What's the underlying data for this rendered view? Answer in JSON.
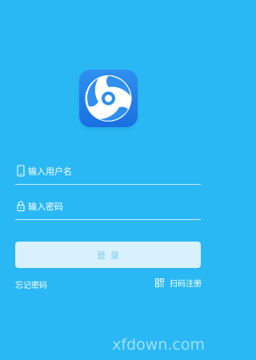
{
  "colors": {
    "background": "#2ab8f4",
    "logo_tile": "#1a6fe0",
    "button_bg": "#d8f1fc",
    "button_text": "#7fcdef"
  },
  "logo": {
    "icon": "swirl-logo-icon"
  },
  "login_form": {
    "username_placeholder": "输入用户名",
    "username_icon": "phone-icon",
    "password_placeholder": "输入密码",
    "password_icon": "lock-icon",
    "submit_label": "登录"
  },
  "links": {
    "forgot_password": "忘记密码",
    "scan_register": "扫码注册",
    "scan_icon": "qr-code-icon"
  },
  "watermark": "xfdown.com"
}
